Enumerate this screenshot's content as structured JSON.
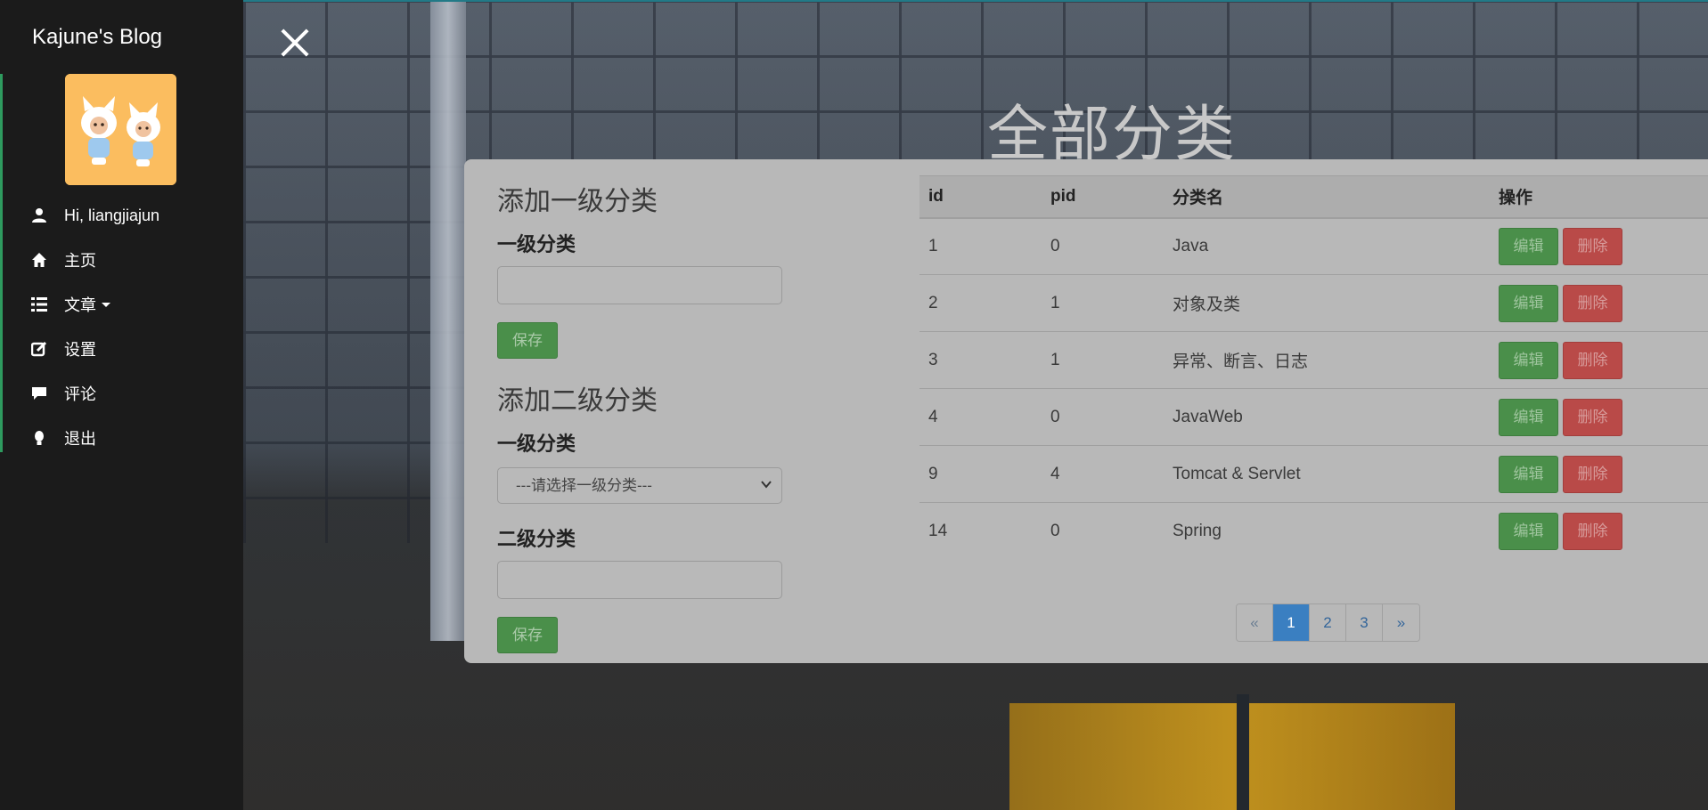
{
  "sidebar": {
    "brand": "Kajune's Blog",
    "greeting": "Hi, liangjiajun",
    "items": [
      {
        "label": "主页",
        "icon": "home-icon"
      },
      {
        "label": "文章",
        "icon": "list-icon",
        "has_caret": true
      },
      {
        "label": "设置",
        "icon": "edit-icon"
      },
      {
        "label": "评论",
        "icon": "comment-icon"
      },
      {
        "label": "退出",
        "icon": "lightbulb-icon"
      }
    ]
  },
  "page": {
    "title": "全部分类"
  },
  "form": {
    "primary_section_title": "添加一级分类",
    "primary_label": "一级分类",
    "primary_input_value": "",
    "primary_save": "保存",
    "secondary_section_title": "添加二级分类",
    "secondary_parent_label": "一级分类",
    "secondary_select_value": "---请选择一级分类---",
    "secondary_label": "二级分类",
    "secondary_input_value": "",
    "secondary_save": "保存"
  },
  "table": {
    "headers": [
      "id",
      "pid",
      "分类名",
      "操作"
    ],
    "edit_label": "编辑",
    "delete_label": "删除",
    "rows": [
      {
        "id": "1",
        "pid": "0",
        "name": "Java"
      },
      {
        "id": "2",
        "pid": "1",
        "name": "对象及类"
      },
      {
        "id": "3",
        "pid": "1",
        "name": "异常、断言、日志"
      },
      {
        "id": "4",
        "pid": "0",
        "name": "JavaWeb"
      },
      {
        "id": "9",
        "pid": "4",
        "name": "Tomcat & Servlet"
      },
      {
        "id": "14",
        "pid": "0",
        "name": "Spring"
      }
    ]
  },
  "pagination": {
    "prev": "«",
    "pages": [
      "1",
      "2",
      "3"
    ],
    "current": "1",
    "next": "»"
  },
  "colors": {
    "accent_green": "#4a8f4a",
    "danger_red": "#b94a48",
    "active_page": "#3a7fc1",
    "sidebar_bg": "#1b1b1b"
  }
}
